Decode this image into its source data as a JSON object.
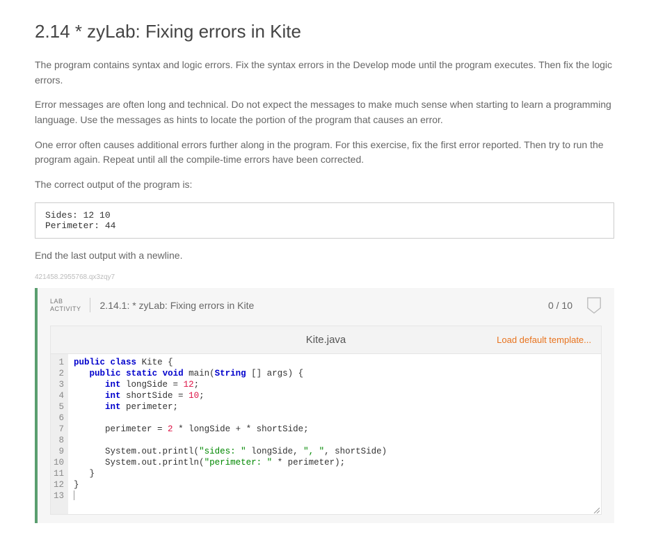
{
  "heading": "2.14 * zyLab: Fixing errors in Kite",
  "para1": "The program contains syntax and logic errors. Fix the syntax errors in the Develop mode until the program executes. Then fix the logic errors.",
  "para2": "Error messages are often long and technical. Do not expect the messages to make much sense when starting to learn a programming language. Use the messages as hints to locate the portion of the program that causes an error.",
  "para3": "One error often causes additional errors further along in the program. For this exercise, fix the first error reported. Then try to run the program again. Repeat until all the compile-time errors have been corrected.",
  "para4": "The correct output of the program is:",
  "expected_output": "Sides: 12 10\nPerimeter: 44",
  "para5": "End the last output with a newline.",
  "tiny_id": "421458.2955768.qx3zqy7",
  "lab_badge_line1": "LAB",
  "lab_badge_line2": "ACTIVITY",
  "activity_title": "2.14.1: * zyLab: Fixing errors in Kite",
  "score": "0 / 10",
  "file_name": "Kite.java",
  "load_template": "Load default template...",
  "gutter": " 1\n 2\n 3\n 4\n 5\n 6\n 7\n 8\n 9\n10\n11\n12\n13",
  "code": {
    "l1_kw1": "public",
    "l1_kw2": "class",
    "l1_cls": "Kite",
    "l1_brace": " {",
    "l2_indent": "   ",
    "l2_kw1": "public",
    "l2_kw2": "static",
    "l2_kw3": "void",
    "l2_main": " main(",
    "l2_type": "String",
    "l2_rest": " [] args) {",
    "l3_indent": "      ",
    "l3_type": "int",
    "l3_rest": " longSide = ",
    "l3_num": "12",
    "l3_semi": ";",
    "l4_indent": "      ",
    "l4_type": "int",
    "l4_rest": " shortSide = ",
    "l4_num": "10",
    "l4_semi": ";",
    "l5_indent": "      ",
    "l5_type": "int",
    "l5_rest": " perimeter;",
    "l6": "",
    "l7_indent": "      ",
    "l7_rest1": "perimeter = ",
    "l7_num": "2",
    "l7_rest2": " * longSide + * shortSide;",
    "l8": "",
    "l9_indent": "      ",
    "l9_call": "System.out.printl(",
    "l9_str1": "\"sides: \"",
    "l9_mid": " longSide, ",
    "l9_str2": "\", \"",
    "l9_end": ", shortSide)",
    "l10_indent": "      ",
    "l10_call": "System.out.println(",
    "l10_str": "\"perimeter: \"",
    "l10_end": " * perimeter);",
    "l11": "   }",
    "l12": "}",
    "l13": ""
  }
}
